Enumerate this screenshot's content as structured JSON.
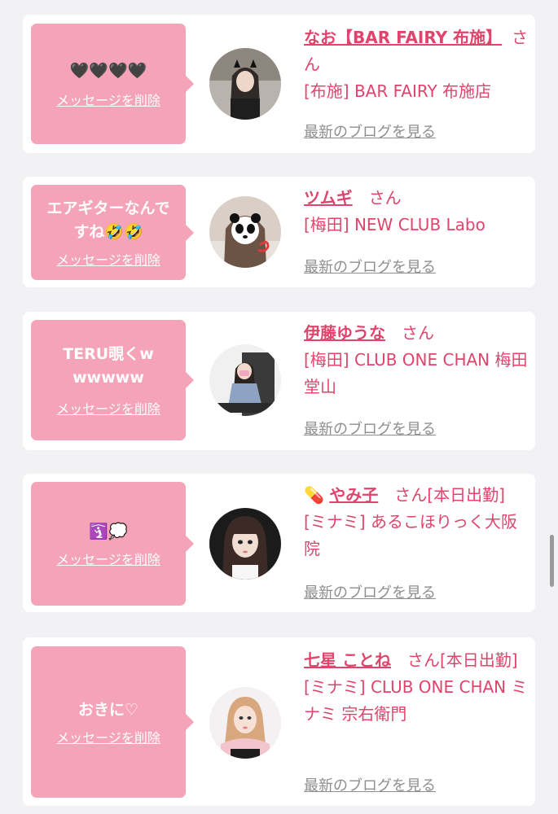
{
  "del_label": "メッセージを削除",
  "blog_label": "最新のブログを見る",
  "cards": [
    {
      "message": "🖤🖤🖤🖤",
      "name": "なお【BAR FAIRY 布施】",
      "san": "さん",
      "status": "",
      "shop": "[布施] BAR FAIRY 布施店"
    },
    {
      "message": "エアギターなんですね🤣🤣",
      "name": "ツムギ",
      "san": "さん",
      "status": "",
      "shop": "[梅田] NEW CLUB Labo"
    },
    {
      "message": "TERU覗くwwwwww",
      "name": "伊藤ゆうな",
      "san": "さん",
      "status": "",
      "shop": "[梅田] CLUB ONE CHAN 梅田堂山"
    },
    {
      "message": "🛐💭",
      "name_icon": "💊",
      "name": "やみ子",
      "san": "さん",
      "status": "[本日出勤]",
      "shop": "[ミナミ] あるこほりっく大阪院"
    },
    {
      "message": "おきに♡",
      "name": "七星 ことね",
      "san": "さん",
      "status": "[本日出勤]",
      "shop": "[ミナミ] CLUB ONE CHAN ミナミ 宗右衛門"
    }
  ],
  "colors": {
    "accent": "#e0446c",
    "bubble": "#f5a3b8",
    "link_gray": "#8e8e8e",
    "background": "#f2f2f4"
  }
}
